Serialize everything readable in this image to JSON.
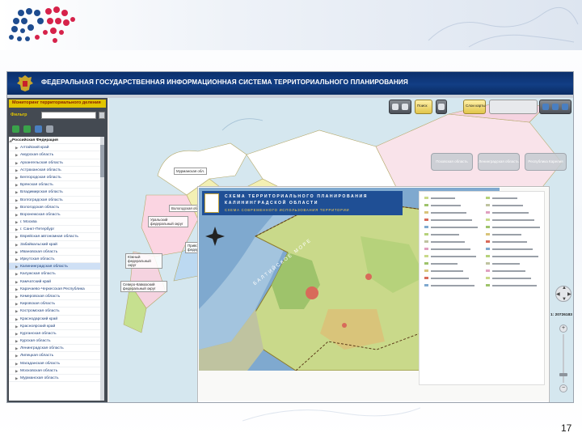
{
  "app": {
    "title": "ФЕДЕРАЛЬНАЯ ГОСУДАРСТВЕННАЯ ИНФОРМАЦИОННАЯ СИСТЕМА ТЕРРИТОРИАЛЬНОГО ПЛАНИРОВАНИЯ"
  },
  "sidebar": {
    "panel_title": "Мониторинг территориального деления",
    "filter_label": "Фильтр",
    "tree": [
      {
        "label": "Российская Федерация",
        "level": 0,
        "selected": false
      },
      {
        "label": "Алтайский край",
        "level": 1,
        "selected": false
      },
      {
        "label": "Амурская область",
        "level": 1,
        "selected": false
      },
      {
        "label": "Архангельская область",
        "level": 1,
        "selected": false
      },
      {
        "label": "Астраханская область",
        "level": 1,
        "selected": false
      },
      {
        "label": "Белгородская область",
        "level": 1,
        "selected": false
      },
      {
        "label": "Брянская область",
        "level": 1,
        "selected": false
      },
      {
        "label": "Владимирская область",
        "level": 1,
        "selected": false
      },
      {
        "label": "Волгоградская область",
        "level": 1,
        "selected": false
      },
      {
        "label": "Вологодская область",
        "level": 1,
        "selected": false
      },
      {
        "label": "Воронежская область",
        "level": 1,
        "selected": false
      },
      {
        "label": "г. Москва",
        "level": 1,
        "selected": false
      },
      {
        "label": "г. Санкт-Петербург",
        "level": 1,
        "selected": false
      },
      {
        "label": "Еврейская автономная область",
        "level": 1,
        "selected": false
      },
      {
        "label": "Забайкальский край",
        "level": 1,
        "selected": false
      },
      {
        "label": "Ивановская область",
        "level": 1,
        "selected": false
      },
      {
        "label": "Иркутская область",
        "level": 1,
        "selected": false
      },
      {
        "label": "Калининградская область",
        "level": 1,
        "selected": true
      },
      {
        "label": "Калужская область",
        "level": 1,
        "selected": false
      },
      {
        "label": "Камчатский край",
        "level": 1,
        "selected": false
      },
      {
        "label": "Карачаево-Черкесская Республика",
        "level": 1,
        "selected": false
      },
      {
        "label": "Кемеровская область",
        "level": 1,
        "selected": false
      },
      {
        "label": "Кировская область",
        "level": 1,
        "selected": false
      },
      {
        "label": "Костромская область",
        "level": 1,
        "selected": false
      },
      {
        "label": "Краснодарский край",
        "level": 1,
        "selected": false
      },
      {
        "label": "Красноярский край",
        "level": 1,
        "selected": false
      },
      {
        "label": "Курганская область",
        "level": 1,
        "selected": false
      },
      {
        "label": "Курская область",
        "level": 1,
        "selected": false
      },
      {
        "label": "Ленинградская область",
        "level": 1,
        "selected": false
      },
      {
        "label": "Липецкая область",
        "level": 1,
        "selected": false
      },
      {
        "label": "Магаданская область",
        "level": 1,
        "selected": false
      },
      {
        "label": "Московская область",
        "level": 1,
        "selected": false
      },
      {
        "label": "Мурманская область",
        "level": 1,
        "selected": false
      }
    ]
  },
  "toolbar": {
    "search_label": "Поиск",
    "layers_label": "Слои карты"
  },
  "map": {
    "crumb": "",
    "region_buttons": [
      "Псковская область",
      "Ленинградская область",
      "Республика Карелия"
    ],
    "region_labels": [
      "Мурманская обл.",
      "Вологодская область",
      "Уральский федеральный округ",
      "Приволжский федеральный округ",
      "Северо-Кавказский федеральный округ",
      "Южный федеральный округ"
    ],
    "sea_label": "БАЛТИЙСКОЕ МОРЕ",
    "scale": "1: 20726183"
  },
  "inset": {
    "title_line1": "СХЕМА ТЕРРИТОРИАЛЬНОГО ПЛАНИРОВАНИЯ",
    "title_line2": "КАЛИНИНГРАДСКОЙ ОБЛАСТИ",
    "title_line3": "СХЕМА СОВРЕМЕННОГО ИСПОЛЬЗОВАНИЯ ТЕРРИТОРИИ"
  },
  "page_number": "17",
  "colors": {
    "header_blue": "#0a2f6b",
    "panel_yellow": "#e1c400",
    "sidebar_dark": "#444a52",
    "selected_row": "#cfe0f5",
    "sea": "#7fa9cf",
    "land_green": "#c9d98a"
  }
}
